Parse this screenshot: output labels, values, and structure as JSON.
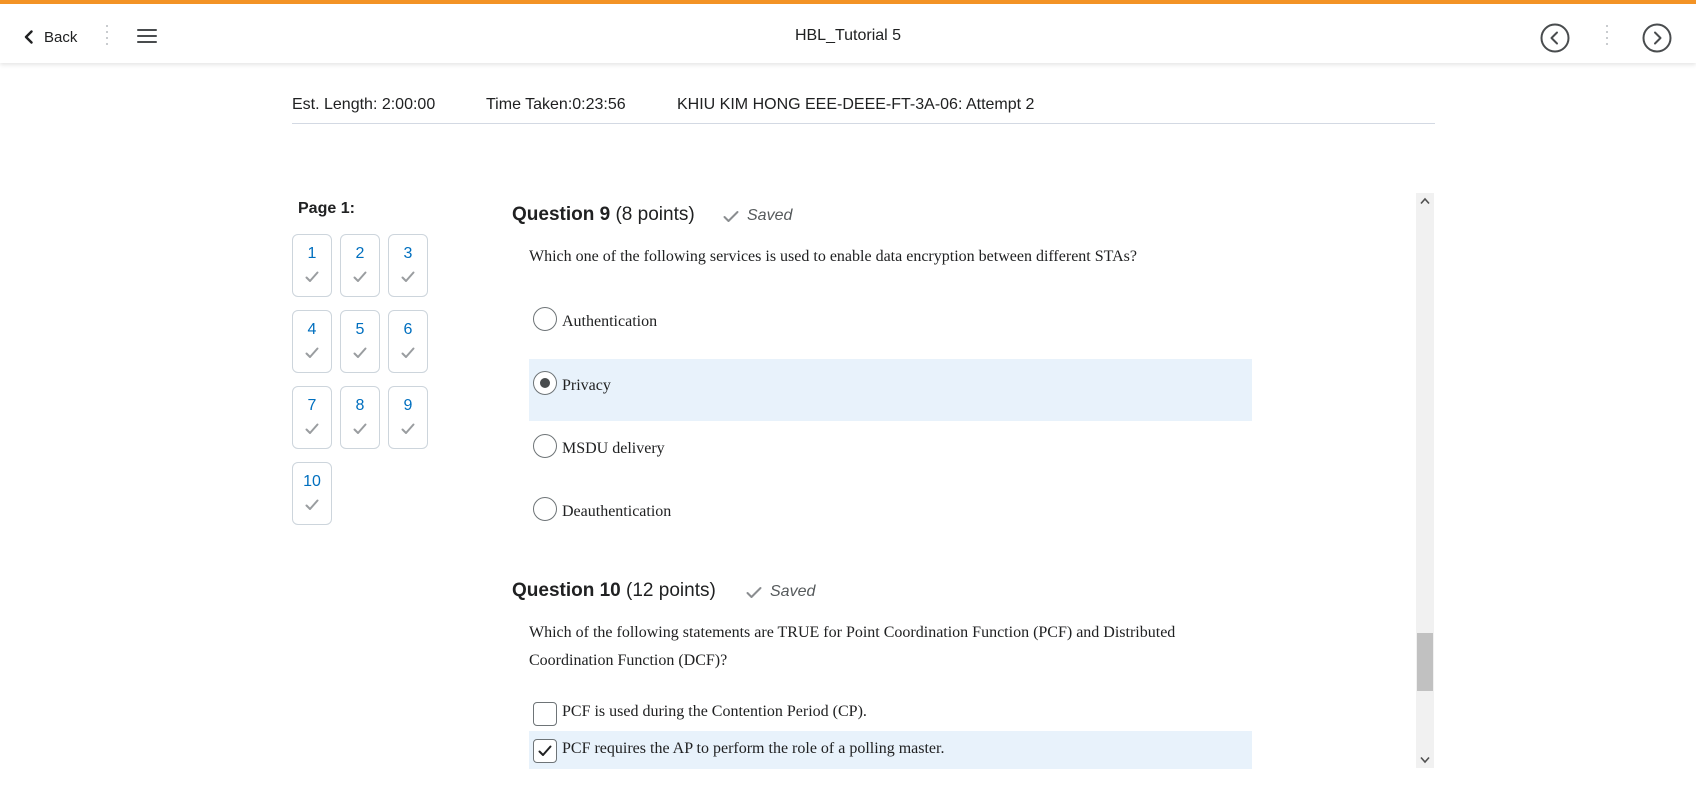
{
  "nav": {
    "back_label": "Back",
    "title": "HBL_Tutorial 5",
    "accent_color": "#f39325"
  },
  "info": {
    "est_length": "Est. Length: 2:00:00",
    "time_taken": "Time Taken:0:23:56",
    "attempt": "KHIU KIM HONG EEE-DEEE-FT-3A-06: Attempt 2"
  },
  "question_nav": {
    "page_label": "Page 1:",
    "items": [
      "1",
      "2",
      "3",
      "4",
      "5",
      "6",
      "7",
      "8",
      "9",
      "10"
    ]
  },
  "q9": {
    "title": "Question 9",
    "points": "(8 points)",
    "saved": "Saved",
    "text": "Which one of the following services is used to enable data encryption between different STAs?",
    "options": [
      "Authentication",
      "Privacy",
      "MSDU delivery",
      "Deauthentication"
    ],
    "selected": "Privacy"
  },
  "q10": {
    "title": "Question 10",
    "points": "(12 points)",
    "saved": "Saved",
    "text": "Which of the following statements are TRUE for Point Coordination Function (PCF) and Distributed Coordination Function (DCF)?",
    "options": [
      {
        "label": "PCF is used during the Contention Period (CP).",
        "checked": false
      },
      {
        "label": "PCF requires the AP to perform the role of a polling master.",
        "checked": true
      }
    ]
  },
  "icons": {
    "back": "chevron-left-icon",
    "menu": "hamburger-menu-icon",
    "prev": "circle-chevron-left-icon",
    "next": "circle-chevron-right-icon",
    "saved": "checkmark-icon"
  }
}
